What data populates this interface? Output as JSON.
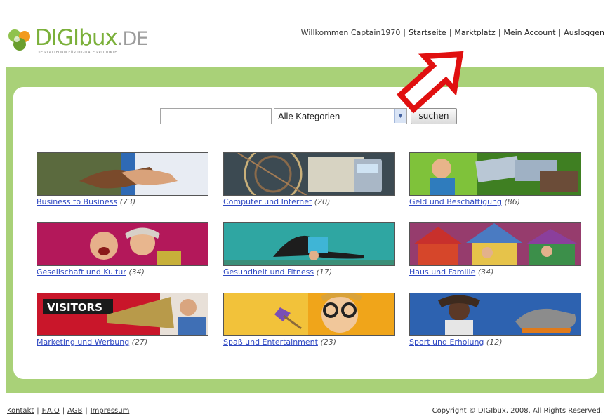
{
  "header": {
    "logo_main": "DIGIbux",
    "logo_suffix": ".DE",
    "logo_tagline": "DIE PLATTFORM FÜR DIGITALE PRODUKTE"
  },
  "nav": {
    "welcome": "Willkommen Captain1970",
    "links": [
      "Startseite",
      "Marktplatz",
      "Mein Account",
      "Ausloggen"
    ]
  },
  "search": {
    "input_value": "",
    "category_selected": "Alle Kategorien",
    "submit_label": "suchen"
  },
  "categories": [
    {
      "name": "Business to Business",
      "count": "(73)"
    },
    {
      "name": "Computer und Internet",
      "count": "(20)"
    },
    {
      "name": "Geld und Beschäftigung",
      "count": "(86)"
    },
    {
      "name": "Gesellschaft und Kultur",
      "count": "(34)"
    },
    {
      "name": "Gesundheit und Fitness",
      "count": "(17)"
    },
    {
      "name": "Haus und Familie",
      "count": "(34)"
    },
    {
      "name": "Marketing und Werbung",
      "count": "(27)"
    },
    {
      "name": "Spaß und Entertainment",
      "count": "(23)"
    },
    {
      "name": "Sport und Erholung",
      "count": "(12)"
    }
  ],
  "banner_texts": {
    "visitors": "VISITORS"
  },
  "footer": {
    "links": [
      "Kontakt",
      "F.A.Q",
      "AGB",
      "Impressum"
    ],
    "copyright": "Copyright © DIGIbux, 2008. All Rights Reserved."
  },
  "colors": {
    "brand_green": "#7bb03a",
    "band_green": "#a9d178",
    "link_blue": "#3049c2",
    "arrow_red": "#e01010"
  }
}
